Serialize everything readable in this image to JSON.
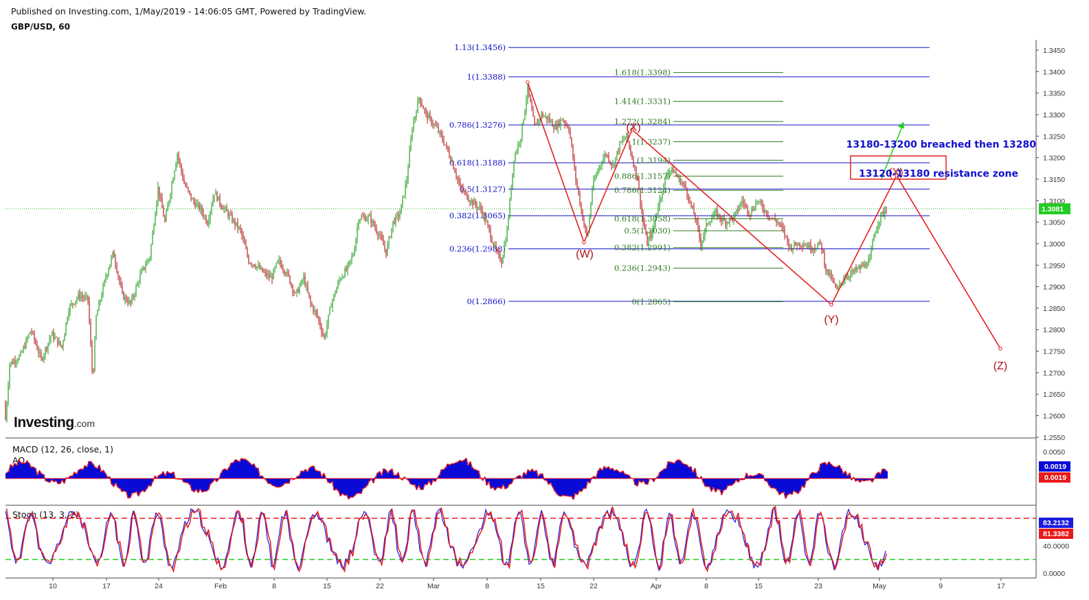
{
  "header": {
    "published": "Published on Investing.com, 1/May/2019 - 14:06:05 GMT, Powered by TradingView.",
    "symbol": "GBP/USD, 60"
  },
  "brand": {
    "name": "Investing",
    "suffix": ".com"
  },
  "colors": {
    "bull": "#1f9e1f",
    "bear": "#b31b1b",
    "fib_blue": "#1010c8",
    "fib_green": "#2d7a1e",
    "wave": "#e32020",
    "price_label_bg": "#22cc22",
    "macd_fill": "#0a0ad6",
    "stoch_signal": "#e81a1a"
  },
  "chart_data": [
    {
      "type": "candlestick",
      "title": "GBP/USD, 60",
      "ylim": [
        1.255,
        1.348
      ],
      "y_ticks": [
        "1.3450",
        "1.3400",
        "1.3350",
        "1.3300",
        "1.3250",
        "1.3200",
        "1.3150",
        "1.3100",
        "1.3050",
        "1.3000",
        "1.2950",
        "1.2900",
        "1.2850",
        "1.2800",
        "1.2750",
        "1.2700",
        "1.2650",
        "1.2600",
        "1.2550"
      ],
      "x_ticks": [
        "10",
        "17",
        "24",
        "Feb",
        "8",
        "15",
        "22",
        "Mar",
        "8",
        "15",
        "22",
        "Apr",
        "8",
        "15",
        "23",
        "May",
        "9",
        "17"
      ],
      "last_price": "1.3081",
      "path": [
        [
          0,
          1.263
        ],
        [
          8,
          1.259
        ],
        [
          14,
          1.272
        ],
        [
          30,
          1.274
        ],
        [
          45,
          1.28
        ],
        [
          60,
          1.273
        ],
        [
          75,
          1.279
        ],
        [
          90,
          1.276
        ],
        [
          100,
          1.285
        ],
        [
          115,
          1.288
        ],
        [
          128,
          1.287
        ],
        [
          135,
          1.268
        ],
        [
          140,
          1.283
        ],
        [
          155,
          1.293
        ],
        [
          165,
          1.298
        ],
        [
          178,
          1.288
        ],
        [
          190,
          1.286
        ],
        [
          205,
          1.293
        ],
        [
          218,
          1.297
        ],
        [
          230,
          1.313
        ],
        [
          240,
          1.305
        ],
        [
          250,
          1.314
        ],
        [
          258,
          1.321
        ],
        [
          268,
          1.314
        ],
        [
          280,
          1.31
        ],
        [
          292,
          1.308
        ],
        [
          302,
          1.305
        ],
        [
          312,
          1.312
        ],
        [
          322,
          1.309
        ],
        [
          336,
          1.306
        ],
        [
          350,
          1.303
        ],
        [
          362,
          1.296
        ],
        [
          372,
          1.295
        ],
        [
          385,
          1.293
        ],
        [
          395,
          1.292
        ],
        [
          405,
          1.296
        ],
        [
          418,
          1.293
        ],
        [
          430,
          1.288
        ],
        [
          442,
          1.292
        ],
        [
          452,
          1.286
        ],
        [
          462,
          1.283
        ],
        [
          472,
          1.278
        ],
        [
          482,
          1.286
        ],
        [
          495,
          1.292
        ],
        [
          505,
          1.294
        ],
        [
          515,
          1.298
        ],
        [
          522,
          1.306
        ],
        [
          538,
          1.306
        ],
        [
          552,
          1.302
        ],
        [
          562,
          1.298
        ],
        [
          572,
          1.305
        ],
        [
          582,
          1.307
        ],
        [
          592,
          1.315
        ],
        [
          600,
          1.327
        ],
        [
          610,
          1.334
        ],
        [
          620,
          1.33
        ],
        [
          635,
          1.327
        ],
        [
          648,
          1.323
        ],
        [
          658,
          1.319
        ],
        [
          670,
          1.313
        ],
        [
          685,
          1.31
        ],
        [
          700,
          1.308
        ],
        [
          712,
          1.303
        ],
        [
          722,
          1.298
        ],
        [
          730,
          1.296
        ],
        [
          738,
          1.303
        ],
        [
          748,
          1.32
        ],
        [
          758,
          1.325
        ],
        [
          768,
          1.336
        ],
        [
          778,
          1.327
        ],
        [
          788,
          1.33
        ],
        [
          798,
          1.329
        ],
        [
          808,
          1.327
        ],
        [
          818,
          1.329
        ],
        [
          828,
          1.327
        ],
        [
          838,
          1.315
        ],
        [
          848,
          1.306
        ],
        [
          855,
          1.301
        ],
        [
          862,
          1.313
        ],
        [
          872,
          1.318
        ],
        [
          882,
          1.321
        ],
        [
          892,
          1.318
        ],
        [
          902,
          1.323
        ],
        [
          912,
          1.325
        ],
        [
          920,
          1.32
        ],
        [
          928,
          1.315
        ],
        [
          935,
          1.306
        ],
        [
          942,
          1.3
        ],
        [
          950,
          1.303
        ],
        [
          958,
          1.309
        ],
        [
          965,
          1.313
        ],
        [
          972,
          1.317
        ],
        [
          980,
          1.317
        ],
        [
          988,
          1.315
        ],
        [
          998,
          1.313
        ],
        [
          1005,
          1.309
        ],
        [
          1012,
          1.306
        ],
        [
          1020,
          1.3
        ],
        [
          1030,
          1.305
        ],
        [
          1042,
          1.307
        ],
        [
          1055,
          1.305
        ],
        [
          1068,
          1.306
        ],
        [
          1080,
          1.31
        ],
        [
          1092,
          1.307
        ],
        [
          1102,
          1.31
        ],
        [
          1112,
          1.308
        ],
        [
          1122,
          1.306
        ],
        [
          1132,
          1.305
        ],
        [
          1140,
          1.303
        ],
        [
          1150,
          1.299
        ],
        [
          1160,
          1.3
        ],
        [
          1170,
          1.3
        ],
        [
          1182,
          1.299
        ],
        [
          1195,
          1.3
        ],
        [
          1202,
          1.294
        ],
        [
          1210,
          1.292
        ],
        [
          1218,
          1.289
        ],
        [
          1228,
          1.292
        ],
        [
          1238,
          1.293
        ],
        [
          1248,
          1.294
        ],
        [
          1258,
          1.295
        ],
        [
          1266,
          1.296
        ],
        [
          1272,
          1.302
        ],
        [
          1278,
          1.305
        ],
        [
          1284,
          1.307
        ],
        [
          1290,
          1.308
        ]
      ]
    },
    {
      "type": "lines",
      "name": "fibonacci-levels",
      "levels": [
        {
          "label": "1.13(1.3456)",
          "price": 1.3456,
          "set": "blue",
          "from": 740,
          "to": 1353
        },
        {
          "label": "1(1.3388)",
          "price": 1.3388,
          "set": "blue",
          "from": 740,
          "to": 1353
        },
        {
          "label": "0.786(1.3276)",
          "price": 1.3276,
          "set": "blue",
          "from": 740,
          "to": 1353
        },
        {
          "label": "0.618(1.3188)",
          "price": 1.3188,
          "set": "blue",
          "from": 740,
          "to": 1353
        },
        {
          "label": "0.5(1.3127)",
          "price": 1.3127,
          "set": "blue",
          "from": 740,
          "to": 1353
        },
        {
          "label": "0.382(1.3065)",
          "price": 1.3065,
          "set": "blue",
          "from": 740,
          "to": 1353
        },
        {
          "label": "0.236(1.2988)",
          "price": 1.2988,
          "set": "blue",
          "from": 740,
          "to": 1353
        },
        {
          "label": "0(1.2866)",
          "price": 1.2866,
          "set": "blue",
          "from": 740,
          "to": 1353
        },
        {
          "label": "1.618(1.3398)",
          "price": 1.3398,
          "set": "green",
          "from": 980,
          "to": 1140
        },
        {
          "label": "1.414(1.3331)",
          "price": 1.3331,
          "set": "green",
          "from": 980,
          "to": 1140
        },
        {
          "label": "1.272(1.3284)",
          "price": 1.3284,
          "set": "green",
          "from": 980,
          "to": 1140
        },
        {
          "label": "1(1.3237)",
          "price": 1.3237,
          "set": "green",
          "from": 980,
          "to": 1140
        },
        {
          "label": "(1.3194)",
          "price": 1.3194,
          "set": "green",
          "from": 980,
          "to": 1140
        },
        {
          "label": "0.886(1.3157)",
          "price": 1.3157,
          "set": "green",
          "from": 980,
          "to": 1140
        },
        {
          "label": "0.786(1.3124)",
          "price": 1.3124,
          "set": "green",
          "from": 980,
          "to": 1140
        },
        {
          "label": "0.618(1.3058)",
          "price": 1.3058,
          "set": "green",
          "from": 980,
          "to": 1140
        },
        {
          "label": "0.5(1.3030)",
          "price": 1.303,
          "set": "green",
          "from": 980,
          "to": 1140
        },
        {
          "label": "0.382(1.2991)",
          "price": 1.2991,
          "set": "green",
          "from": 980,
          "to": 1140
        },
        {
          "label": "0.236(1.2943)",
          "price": 1.2943,
          "set": "green",
          "from": 980,
          "to": 1140
        },
        {
          "label": "0(1.2865)",
          "price": 1.2865,
          "set": "green",
          "from": 980,
          "to": 1140
        }
      ]
    },
    {
      "type": "annotation",
      "name": "elliott-wave",
      "points": [
        [
          768,
          1.3375
        ],
        [
          850,
          1.3003
        ],
        [
          920,
          1.3265
        ],
        [
          1210,
          1.2858
        ],
        [
          1305,
          1.3158
        ],
        [
          1456,
          1.2756
        ]
      ],
      "labels": [
        {
          "text": "(W)",
          "x": 851,
          "price": 1.299
        },
        {
          "text": "(X)",
          "x": 922,
          "price": 1.3285
        },
        {
          "text": "(Y)",
          "x": 1210,
          "price": 1.2838
        },
        {
          "text": "(X)",
          "x": 1304,
          "price": 1.318
        },
        {
          "text": "(Z)",
          "x": 1456,
          "price": 1.273
        }
      ],
      "notes": [
        "13180-13200 breached then 13280",
        "13120-13180 resistance zone"
      ],
      "resistance_box": [
        1.315,
        1.3204
      ],
      "arrow_target": [
        1315,
        1.328
      ]
    },
    {
      "type": "histogram",
      "name": "MACD (12, 26, close, 1)",
      "title": "MACD (12, 26, close, 1)",
      "label2": "AO",
      "ylim": [
        -0.0055,
        0.0075
      ],
      "y_ticks": [
        "0.0050",
        "0.0000"
      ],
      "value_labels": [
        "0.0019",
        "0.0019"
      ]
    },
    {
      "type": "line",
      "name": "Stoch (13, 3, 2)",
      "title": "Stoch (13, 3, 2)",
      "ylim": [
        0,
        100
      ],
      "levels": [
        80,
        20
      ],
      "y_ticks": [
        "40.0000",
        "0.0000"
      ],
      "value_labels": [
        "83.2132",
        "81.3382"
      ]
    }
  ]
}
